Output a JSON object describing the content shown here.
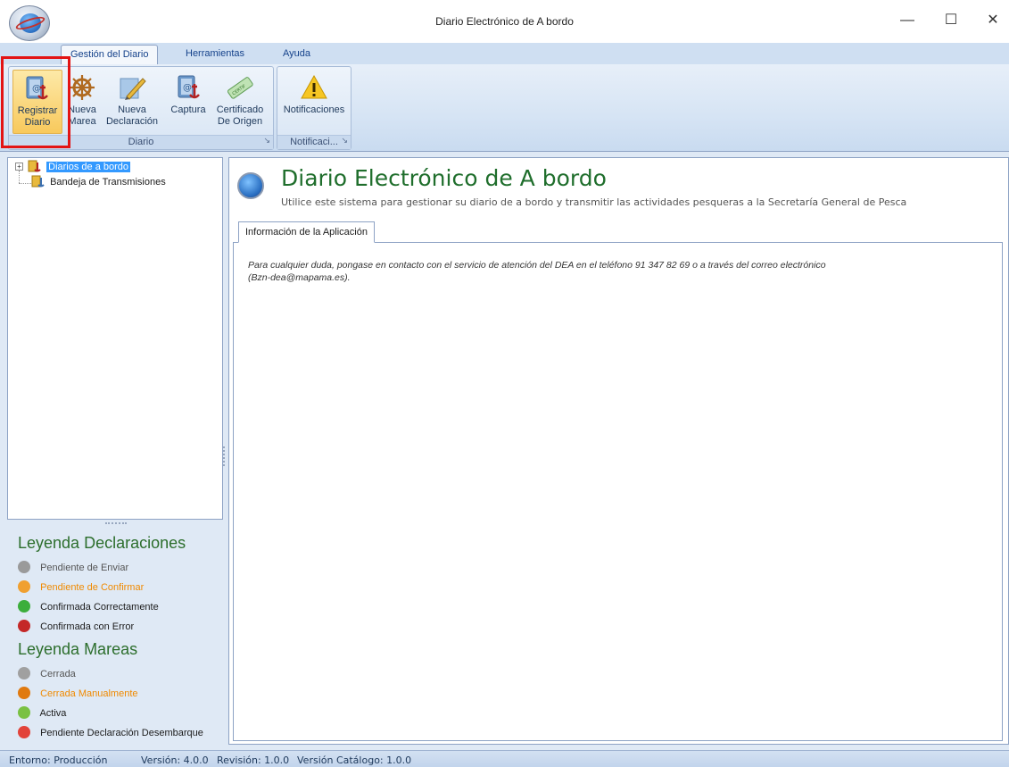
{
  "window": {
    "title": "Diario Electrónico de A bordo",
    "minimize": "—",
    "maximize": "☐",
    "close": "✕"
  },
  "ribbon": {
    "tabs": [
      "Gestión del Diario",
      "Herramientas",
      "Ayuda"
    ],
    "active_tab": "Gestión del Diario",
    "groups": {
      "diario": {
        "label": "Diario",
        "buttons": [
          {
            "line1": "Registrar",
            "line2": "Diario",
            "icon": "register-diary-icon"
          },
          {
            "line1": "Nueva",
            "line2": "Marea",
            "icon": "ship-wheel-icon"
          },
          {
            "line1": "Nueva",
            "line2": "Declaración",
            "icon": "pencil-icon"
          },
          {
            "line1": "Captura",
            "line2": "",
            "icon": "capture-icon"
          },
          {
            "line1": "Certificado",
            "line2": "De Origen",
            "icon": "certificate-icon"
          }
        ]
      },
      "notificaciones": {
        "label": "Notificaci...",
        "buttons": [
          {
            "line1": "Notificaciones",
            "line2": "",
            "icon": "warning-icon"
          }
        ]
      }
    }
  },
  "tree": {
    "items": [
      {
        "label": "Diarios de a bordo",
        "selected": true,
        "expander": "+"
      },
      {
        "label": "Bandeja de Transmisiones",
        "selected": false
      }
    ]
  },
  "legend_declaraciones": {
    "title": "Leyenda Declaraciones",
    "items": [
      {
        "label": "Pendiente de Enviar",
        "color": "#555555",
        "icon_color": "#9a9a9a"
      },
      {
        "label": "Pendiente de Confirmar",
        "color": "#f08a00",
        "icon_color": "#f0a030"
      },
      {
        "label": "Confirmada Correctamente",
        "color": "#1b1b1b",
        "icon_color": "#3cae3c"
      },
      {
        "label": "Confirmada con Error",
        "color": "#1b1b1b",
        "icon_color": "#c42828"
      }
    ]
  },
  "legend_mareas": {
    "title": "Leyenda Mareas",
    "items": [
      {
        "label": "Cerrada",
        "color": "#555555",
        "icon_color": "#a0a0a0"
      },
      {
        "label": "Cerrada Manualmente",
        "color": "#f08a00",
        "icon_color": "#e07a10"
      },
      {
        "label": "Activa",
        "color": "#1b1b1b",
        "icon_color": "#7ac142"
      },
      {
        "label": "Pendiente Declaración Desembarque",
        "color": "#1b1b1b",
        "icon_color": "#e2433a"
      }
    ]
  },
  "content": {
    "title": "Diario Electrónico de A bordo",
    "subtitle": "Utilice este sistema para gestionar su diario de a bordo y transmitir las actividades pesqueras a la Secretaría General de Pesca",
    "tab_label": "Información de la Aplicación",
    "info_line1": "Para cualquier duda, pongase en contacto con el servicio de atención del DEA en el teléfono 91 347 82 69 o a través del correo electrónico",
    "info_line2": "(Bzn-dea@mapama.es)."
  },
  "status": {
    "entorno": "Entorno: Producción",
    "version": "Versión: 4.0.0",
    "revision": "Revisión: 1.0.0",
    "catalogo": "Versión Catálogo: 1.0.0"
  },
  "colors": {
    "highlight": "#e31414",
    "title_green": "#1f6e2c",
    "selection": "#3399ff"
  }
}
